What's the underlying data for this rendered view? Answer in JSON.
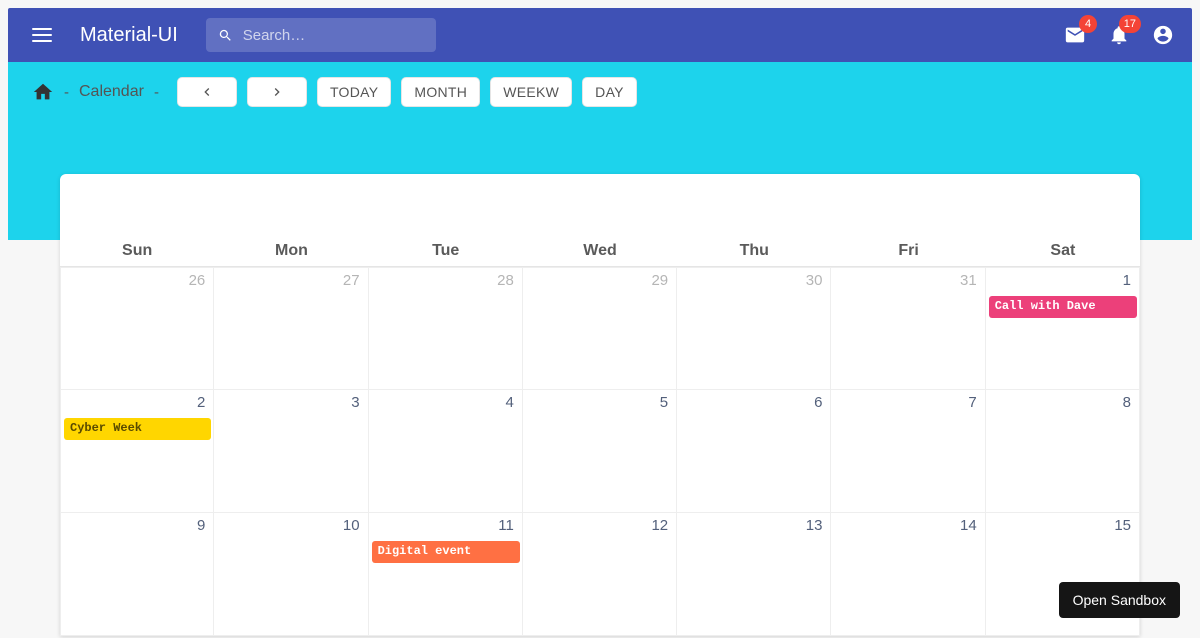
{
  "appbar": {
    "brand": "Material-UI",
    "search_placeholder": "Search…",
    "mail_badge": "4",
    "bell_badge": "17"
  },
  "breadcrumb": {
    "label": "Calendar"
  },
  "toolbar": {
    "today": "TODAY",
    "month": "MONTH",
    "week": "WEEKW",
    "day": "DAY"
  },
  "days": [
    "Sun",
    "Mon",
    "Tue",
    "Wed",
    "Thu",
    "Fri",
    "Sat"
  ],
  "rows": [
    [
      {
        "n": "26",
        "muted": true
      },
      {
        "n": "27",
        "muted": true
      },
      {
        "n": "28",
        "muted": true
      },
      {
        "n": "29",
        "muted": true
      },
      {
        "n": "30",
        "muted": true
      },
      {
        "n": "31",
        "muted": true
      },
      {
        "n": "1",
        "event": {
          "label": "Call with Dave",
          "color": "#ec407a"
        }
      }
    ],
    [
      {
        "n": "2",
        "event": {
          "label": "Cyber Week",
          "color": "#ffd600",
          "textDark": true
        }
      },
      {
        "n": "3"
      },
      {
        "n": "4"
      },
      {
        "n": "5"
      },
      {
        "n": "6"
      },
      {
        "n": "7"
      },
      {
        "n": "8"
      }
    ],
    [
      {
        "n": "9"
      },
      {
        "n": "10"
      },
      {
        "n": "11",
        "event": {
          "label": "Digital event",
          "color": "#ff7043"
        }
      },
      {
        "n": "12"
      },
      {
        "n": "13"
      },
      {
        "n": "14"
      },
      {
        "n": "15"
      }
    ]
  ],
  "sandbox_label": "Open Sandbox"
}
